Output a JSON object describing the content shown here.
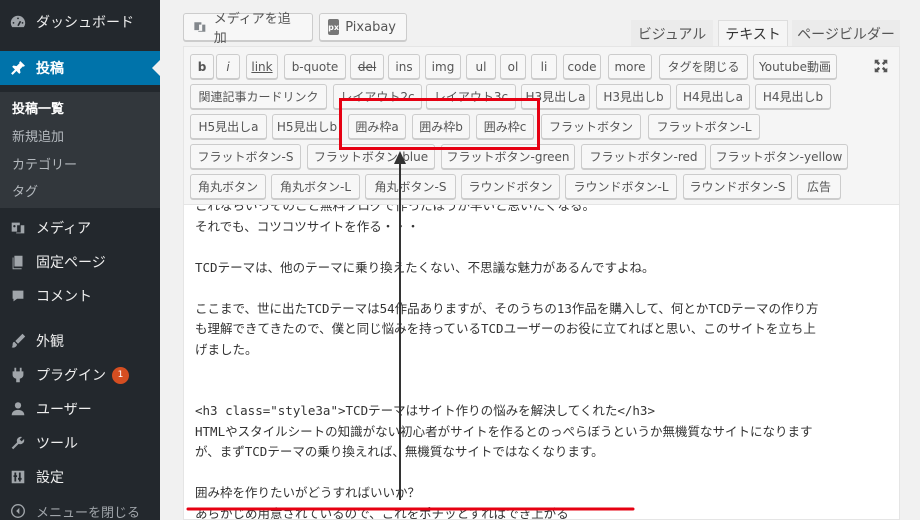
{
  "sidebar": {
    "dashboard": "ダッシュボード",
    "posts": "投稿",
    "submenu": [
      "投稿一覧",
      "新規追加",
      "カテゴリー",
      "タグ"
    ],
    "media": "メディア",
    "pages": "固定ページ",
    "comments": "コメント",
    "appearance": "外観",
    "plugins": "プラグイン",
    "plugins_badge": "1",
    "users": "ユーザー",
    "tools": "ツール",
    "settings": "設定",
    "collapse": "メニューを閉じる"
  },
  "editor": {
    "add_media": "メディアを追加",
    "pixabay": "Pixabay",
    "pixabay_logo": "px",
    "tabs": [
      "ビジュアル",
      "テキスト",
      "ページビルダー"
    ],
    "active_tab": "テキスト",
    "toolbar": [
      "b",
      "i",
      "link",
      "b-quote",
      "del",
      "ins",
      "img",
      "ul",
      "ol",
      "li",
      "code",
      "more",
      "タグを閉じる",
      "Youtube動画",
      "関連記事カードリンク",
      "レイアウト2c",
      "レイアウト3c",
      "H3見出しa",
      "H3見出しb",
      "H4見出しa",
      "H4見出しb",
      "H5見出しa",
      "H5見出しb",
      "囲み枠a",
      "囲み枠b",
      "囲み枠c",
      "フラットボタン",
      "フラットボタン-L",
      "フラットボタン-S",
      "フラットボタン-blue",
      "フラットボタン-green",
      "フラットボタン-red",
      "フラットボタン-yellow",
      "角丸ボタン",
      "角丸ボタン-L",
      "角丸ボタン-S",
      "ラウンドボタン",
      "ラウンドボタン-L",
      "ラウンドボタン-S",
      "広告"
    ],
    "content_lines": [
      "これならいっそのこと無料ブログで作ったほうが早いと思いたくなる。",
      "それでも、コツコツサイトを作る・・・",
      "",
      "TCDテーマは、他のテーマに乗り換えたくない、不思議な魅力があるんですよね。",
      "",
      "ここまで、世に出たTCDテーマは54作品ありますが、そのうちの13作品を購入して、何とかTCDテーマの作り方",
      "も理解できてきたので、僕と同じ悩みを持っているTCDユーザーのお役に立てればと思い、このサイトを立ち上",
      "げました。",
      "",
      "",
      "<h3 class=\"style3a\">TCDテーマはサイト作りの悩みを解決してくれた</h3>",
      "HTMLやスタイルシートの知識がない初心者がサイトを作るとのっぺらぼうというか無機質なサイトになります",
      "が、まずTCDテーマの乗り換えれば、無機質なサイトではなくなります。",
      "",
      "囲み枠を作りたいがどうすればいいか？",
      "あらかじめ用意されているので、これをポチッとすればでき上がる"
    ]
  },
  "colors": {
    "sidebar_bg": "#23282d",
    "active_menu": "#0073aa",
    "annotation_red": "#e60012"
  }
}
